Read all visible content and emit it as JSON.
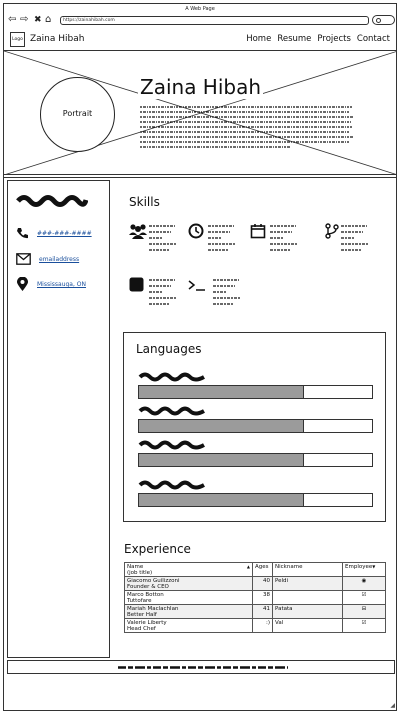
{
  "browser": {
    "title": "A Web Page",
    "url": "https://zainahibah.com"
  },
  "site": {
    "logo": "Logo",
    "brand": "Zaina Hibah",
    "nav": [
      "Home",
      "Resume",
      "Projects",
      "Contact"
    ]
  },
  "hero": {
    "portrait": "Portrait",
    "name": "Zaina Hibah"
  },
  "contact": {
    "phone": "###-###-####",
    "email": "emailaddress",
    "location": "Mississauga, ON"
  },
  "skills": {
    "heading": "Skills",
    "icons": [
      "group-icon",
      "clock-icon",
      "calendar-icon",
      "branch-icon",
      "square-icon",
      "terminal-icon"
    ]
  },
  "languages": {
    "heading": "Languages",
    "levels": [
      0.71,
      0.71,
      0.71,
      0.71
    ]
  },
  "experience": {
    "heading": "Experience",
    "columns": [
      "Name\n(job title)",
      "Ages",
      "Nickname",
      "Employee"
    ],
    "rows": [
      {
        "name": "Giacomo Guilizzoni",
        "title": "Founder & CEO",
        "age": "40",
        "nickname": "Peldi",
        "employee": "radio"
      },
      {
        "name": "Marco Botton",
        "title": "Tuttofare",
        "age": "38",
        "nickname": "",
        "employee": "checked"
      },
      {
        "name": "Mariah Maclachlan",
        "title": "Better Half",
        "age": "41",
        "nickname": "Patata",
        "employee": "indeterminate"
      },
      {
        "name": "Valerie Liberty",
        "title": "Head Chef",
        "age": ":)",
        "nickname": "Val",
        "employee": "checked"
      }
    ]
  }
}
